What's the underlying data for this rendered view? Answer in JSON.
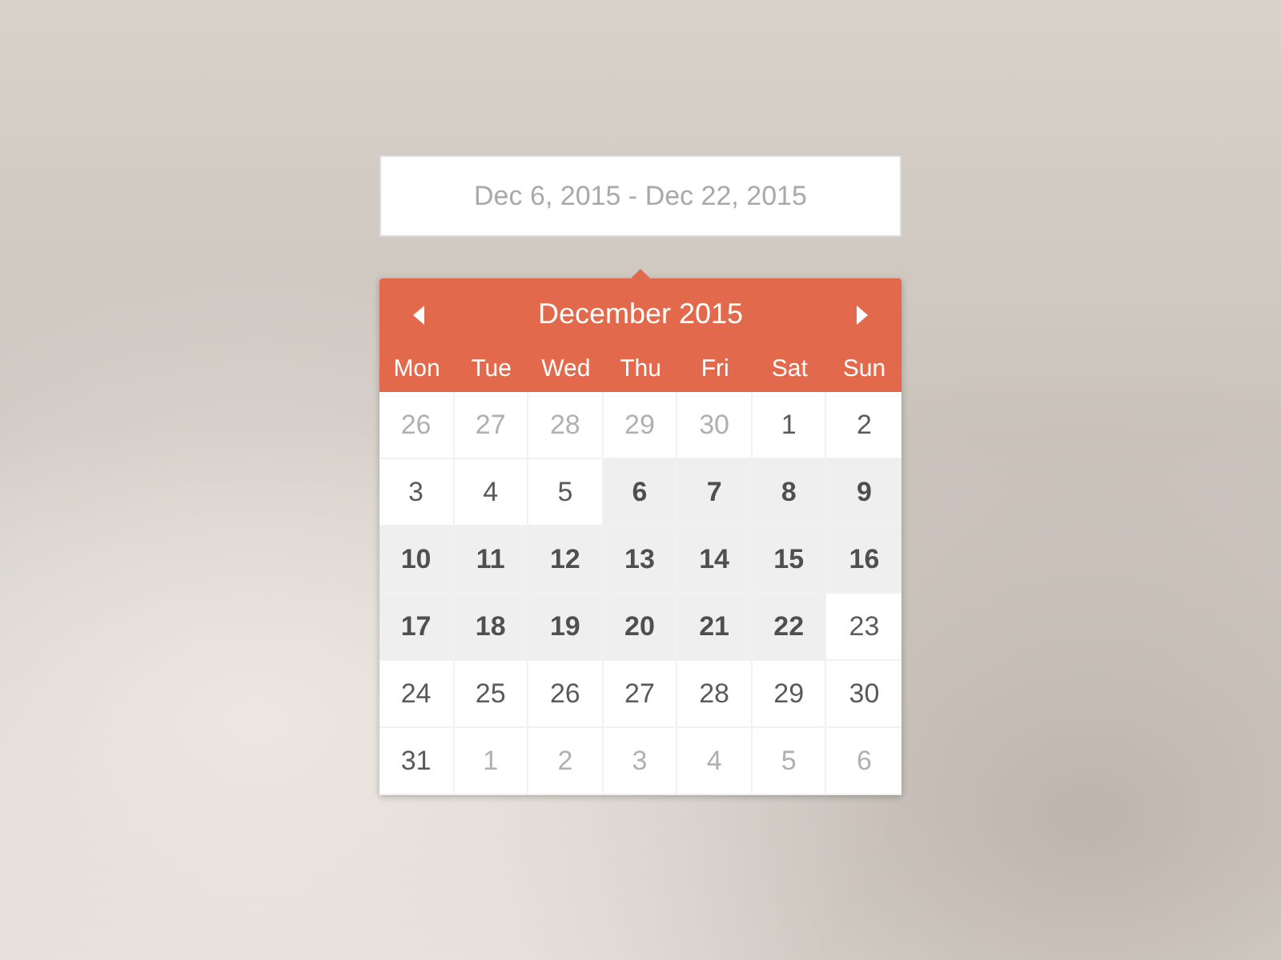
{
  "date_field": {
    "value": "Dec 6, 2015 - Dec 22, 2015"
  },
  "calendar": {
    "title": "December 2015",
    "weekdays": [
      "Mon",
      "Tue",
      "Wed",
      "Thu",
      "Fri",
      "Sat",
      "Sun"
    ],
    "days": [
      {
        "label": "26",
        "muted": true,
        "selected": false
      },
      {
        "label": "27",
        "muted": true,
        "selected": false
      },
      {
        "label": "28",
        "muted": true,
        "selected": false
      },
      {
        "label": "29",
        "muted": true,
        "selected": false
      },
      {
        "label": "30",
        "muted": true,
        "selected": false
      },
      {
        "label": "1",
        "muted": false,
        "selected": false
      },
      {
        "label": "2",
        "muted": false,
        "selected": false
      },
      {
        "label": "3",
        "muted": false,
        "selected": false
      },
      {
        "label": "4",
        "muted": false,
        "selected": false
      },
      {
        "label": "5",
        "muted": false,
        "selected": false
      },
      {
        "label": "6",
        "muted": false,
        "selected": true
      },
      {
        "label": "7",
        "muted": false,
        "selected": true
      },
      {
        "label": "8",
        "muted": false,
        "selected": true
      },
      {
        "label": "9",
        "muted": false,
        "selected": true
      },
      {
        "label": "10",
        "muted": false,
        "selected": true
      },
      {
        "label": "11",
        "muted": false,
        "selected": true
      },
      {
        "label": "12",
        "muted": false,
        "selected": true
      },
      {
        "label": "13",
        "muted": false,
        "selected": true
      },
      {
        "label": "14",
        "muted": false,
        "selected": true
      },
      {
        "label": "15",
        "muted": false,
        "selected": true
      },
      {
        "label": "16",
        "muted": false,
        "selected": true
      },
      {
        "label": "17",
        "muted": false,
        "selected": true
      },
      {
        "label": "18",
        "muted": false,
        "selected": true
      },
      {
        "label": "19",
        "muted": false,
        "selected": true
      },
      {
        "label": "20",
        "muted": false,
        "selected": true
      },
      {
        "label": "21",
        "muted": false,
        "selected": true
      },
      {
        "label": "22",
        "muted": false,
        "selected": true
      },
      {
        "label": "23",
        "muted": false,
        "selected": false
      },
      {
        "label": "24",
        "muted": false,
        "selected": false
      },
      {
        "label": "25",
        "muted": false,
        "selected": false
      },
      {
        "label": "26",
        "muted": false,
        "selected": false
      },
      {
        "label": "27",
        "muted": false,
        "selected": false
      },
      {
        "label": "28",
        "muted": false,
        "selected": false
      },
      {
        "label": "29",
        "muted": false,
        "selected": false
      },
      {
        "label": "30",
        "muted": false,
        "selected": false
      },
      {
        "label": "31",
        "muted": false,
        "selected": false
      },
      {
        "label": "1",
        "muted": true,
        "selected": false
      },
      {
        "label": "2",
        "muted": true,
        "selected": false
      },
      {
        "label": "3",
        "muted": true,
        "selected": false
      },
      {
        "label": "4",
        "muted": true,
        "selected": false
      },
      {
        "label": "5",
        "muted": true,
        "selected": false
      },
      {
        "label": "6",
        "muted": true,
        "selected": false
      }
    ]
  }
}
